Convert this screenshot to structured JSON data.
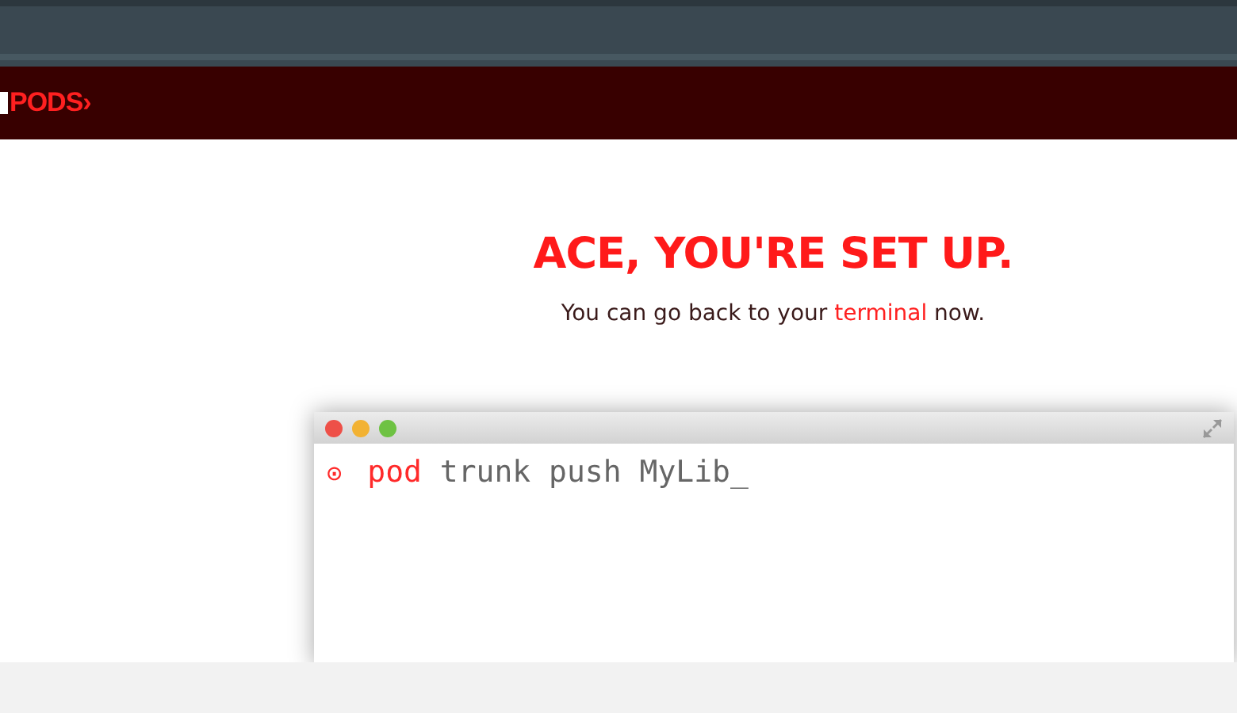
{
  "header": {
    "logo": "PODS›"
  },
  "hero": {
    "title": "ACE, YOU'RE SET UP.",
    "subtitle": {
      "before": "You can go back to your ",
      "link": "terminal",
      "after": " now."
    }
  },
  "terminal": {
    "prompt": "⊙",
    "command": "pod",
    "arguments": "trunk push MyLib",
    "cursor": "_"
  }
}
